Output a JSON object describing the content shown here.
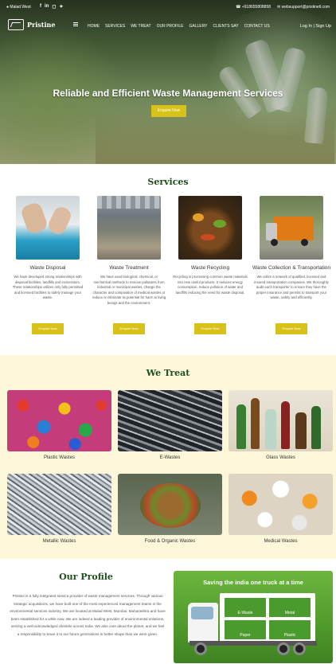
{
  "topbar": {
    "location": "Malad West",
    "socials": [
      "f",
      "in",
      "ig",
      "tw"
    ],
    "phone": "+918655808858",
    "email": "websupport@pristinetl.com"
  },
  "nav": {
    "logo_text": "Pristine",
    "menu": [
      "HOME",
      "SERVICES",
      "WE TREAT",
      "OUR PROFILE",
      "GALLERY",
      "CLIENTS SAY",
      "CONTACT US"
    ],
    "login": "Log In | Sign Up"
  },
  "hero": {
    "title": "Reliable and Efficient Waste Management Services",
    "button": "Enquire Now"
  },
  "services": {
    "title": "Services",
    "items": [
      {
        "name": "Waste Disposal",
        "desc": "We have developed strong relationships with disposal facilities, landfills and incinerators. These relationships utilizes only fully permitted and licensed facilities to safely manage your waste.",
        "button": "Enquire Now"
      },
      {
        "name": "Waste Treatment",
        "desc": "We have used biological, chemical, or mechanical methods to remove pollutants from industrial or municipal wastes, change the character and composition of medical wastes or reduce or eliminate its potential for harm to living beings and the environment.",
        "button": "Enquire Now"
      },
      {
        "name": "Waste Recycling",
        "desc": "Recycling is processing common waste materials into new useful products. It reduces energy consumption, reduce pollution of water and landfills reducing the need for waste disposal.",
        "button": "Enquire Now"
      },
      {
        "name": "Waste Collection & Transportation",
        "desc": "We utilize a network of qualified, licensed and insured transportation companies. We thoroughly audit each transporter to ensure they have the proper insurance and permits to transport your waste, safely and efficiently.",
        "button": "Enquire Now"
      }
    ]
  },
  "treat": {
    "title": "We Treat",
    "items": [
      "Plastic Wastes",
      "E-Wastes",
      "Glass Wastes",
      "Metallic Wastes",
      "Food & Organic Wastes",
      "Medical Wastes"
    ]
  },
  "profile": {
    "title": "Our Profile",
    "text": "Pristine is a fully integrated service provider of waste management services. Through various strategic acquisitions, we have built one of the most experienced management teams in the environmental services industry. We are located at Malad West, Mumbai, Maharashtra and have been established for a while now. We are indeed a leading provider of environmental solutions, serving a well-acknowledged clientele across India. We also care about the planet, and we feel a responsibility to leave it to our future generations in better shape than we were given.",
    "banner_caption": "Saving the india one truck at a time",
    "truck_labels": [
      "E-Waste",
      "Metal",
      "Paper",
      "Plastic"
    ]
  },
  "colors": {
    "accent_yellow": "#d8c21a",
    "heading_green": "#1f4d1f",
    "treat_bg": "#fbf7d8",
    "banner_green": "#5aa532"
  }
}
